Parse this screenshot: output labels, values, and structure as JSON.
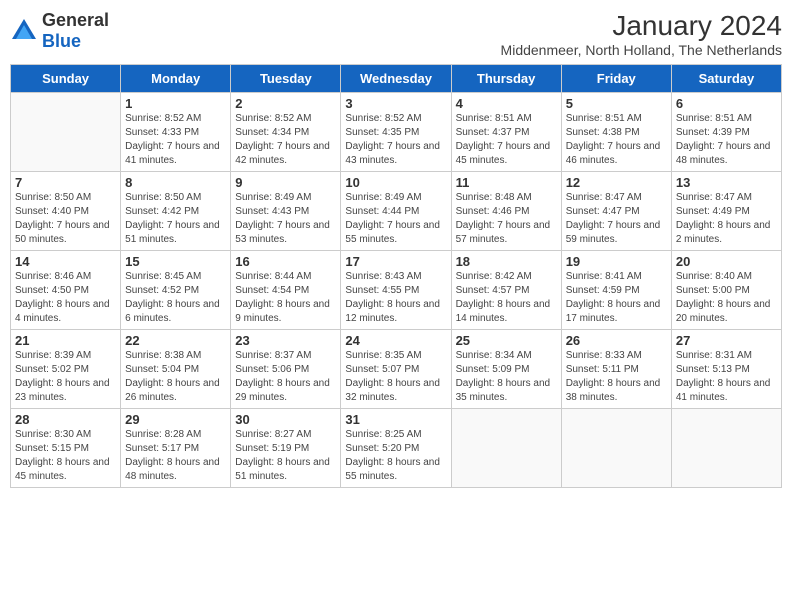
{
  "logo": {
    "general": "General",
    "blue": "Blue"
  },
  "title": "January 2024",
  "subtitle": "Middenmeer, North Holland, The Netherlands",
  "days": [
    "Sunday",
    "Monday",
    "Tuesday",
    "Wednesday",
    "Thursday",
    "Friday",
    "Saturday"
  ],
  "weeks": [
    [
      {
        "day": "",
        "sunrise": "",
        "sunset": "",
        "daylight": ""
      },
      {
        "day": "1",
        "sunrise": "Sunrise: 8:52 AM",
        "sunset": "Sunset: 4:33 PM",
        "daylight": "Daylight: 7 hours and 41 minutes."
      },
      {
        "day": "2",
        "sunrise": "Sunrise: 8:52 AM",
        "sunset": "Sunset: 4:34 PM",
        "daylight": "Daylight: 7 hours and 42 minutes."
      },
      {
        "day": "3",
        "sunrise": "Sunrise: 8:52 AM",
        "sunset": "Sunset: 4:35 PM",
        "daylight": "Daylight: 7 hours and 43 minutes."
      },
      {
        "day": "4",
        "sunrise": "Sunrise: 8:51 AM",
        "sunset": "Sunset: 4:37 PM",
        "daylight": "Daylight: 7 hours and 45 minutes."
      },
      {
        "day": "5",
        "sunrise": "Sunrise: 8:51 AM",
        "sunset": "Sunset: 4:38 PM",
        "daylight": "Daylight: 7 hours and 46 minutes."
      },
      {
        "day": "6",
        "sunrise": "Sunrise: 8:51 AM",
        "sunset": "Sunset: 4:39 PM",
        "daylight": "Daylight: 7 hours and 48 minutes."
      }
    ],
    [
      {
        "day": "7",
        "sunrise": "Sunrise: 8:50 AM",
        "sunset": "Sunset: 4:40 PM",
        "daylight": "Daylight: 7 hours and 50 minutes."
      },
      {
        "day": "8",
        "sunrise": "Sunrise: 8:50 AM",
        "sunset": "Sunset: 4:42 PM",
        "daylight": "Daylight: 7 hours and 51 minutes."
      },
      {
        "day": "9",
        "sunrise": "Sunrise: 8:49 AM",
        "sunset": "Sunset: 4:43 PM",
        "daylight": "Daylight: 7 hours and 53 minutes."
      },
      {
        "day": "10",
        "sunrise": "Sunrise: 8:49 AM",
        "sunset": "Sunset: 4:44 PM",
        "daylight": "Daylight: 7 hours and 55 minutes."
      },
      {
        "day": "11",
        "sunrise": "Sunrise: 8:48 AM",
        "sunset": "Sunset: 4:46 PM",
        "daylight": "Daylight: 7 hours and 57 minutes."
      },
      {
        "day": "12",
        "sunrise": "Sunrise: 8:47 AM",
        "sunset": "Sunset: 4:47 PM",
        "daylight": "Daylight: 7 hours and 59 minutes."
      },
      {
        "day": "13",
        "sunrise": "Sunrise: 8:47 AM",
        "sunset": "Sunset: 4:49 PM",
        "daylight": "Daylight: 8 hours and 2 minutes."
      }
    ],
    [
      {
        "day": "14",
        "sunrise": "Sunrise: 8:46 AM",
        "sunset": "Sunset: 4:50 PM",
        "daylight": "Daylight: 8 hours and 4 minutes."
      },
      {
        "day": "15",
        "sunrise": "Sunrise: 8:45 AM",
        "sunset": "Sunset: 4:52 PM",
        "daylight": "Daylight: 8 hours and 6 minutes."
      },
      {
        "day": "16",
        "sunrise": "Sunrise: 8:44 AM",
        "sunset": "Sunset: 4:54 PM",
        "daylight": "Daylight: 8 hours and 9 minutes."
      },
      {
        "day": "17",
        "sunrise": "Sunrise: 8:43 AM",
        "sunset": "Sunset: 4:55 PM",
        "daylight": "Daylight: 8 hours and 12 minutes."
      },
      {
        "day": "18",
        "sunrise": "Sunrise: 8:42 AM",
        "sunset": "Sunset: 4:57 PM",
        "daylight": "Daylight: 8 hours and 14 minutes."
      },
      {
        "day": "19",
        "sunrise": "Sunrise: 8:41 AM",
        "sunset": "Sunset: 4:59 PM",
        "daylight": "Daylight: 8 hours and 17 minutes."
      },
      {
        "day": "20",
        "sunrise": "Sunrise: 8:40 AM",
        "sunset": "Sunset: 5:00 PM",
        "daylight": "Daylight: 8 hours and 20 minutes."
      }
    ],
    [
      {
        "day": "21",
        "sunrise": "Sunrise: 8:39 AM",
        "sunset": "Sunset: 5:02 PM",
        "daylight": "Daylight: 8 hours and 23 minutes."
      },
      {
        "day": "22",
        "sunrise": "Sunrise: 8:38 AM",
        "sunset": "Sunset: 5:04 PM",
        "daylight": "Daylight: 8 hours and 26 minutes."
      },
      {
        "day": "23",
        "sunrise": "Sunrise: 8:37 AM",
        "sunset": "Sunset: 5:06 PM",
        "daylight": "Daylight: 8 hours and 29 minutes."
      },
      {
        "day": "24",
        "sunrise": "Sunrise: 8:35 AM",
        "sunset": "Sunset: 5:07 PM",
        "daylight": "Daylight: 8 hours and 32 minutes."
      },
      {
        "day": "25",
        "sunrise": "Sunrise: 8:34 AM",
        "sunset": "Sunset: 5:09 PM",
        "daylight": "Daylight: 8 hours and 35 minutes."
      },
      {
        "day": "26",
        "sunrise": "Sunrise: 8:33 AM",
        "sunset": "Sunset: 5:11 PM",
        "daylight": "Daylight: 8 hours and 38 minutes."
      },
      {
        "day": "27",
        "sunrise": "Sunrise: 8:31 AM",
        "sunset": "Sunset: 5:13 PM",
        "daylight": "Daylight: 8 hours and 41 minutes."
      }
    ],
    [
      {
        "day": "28",
        "sunrise": "Sunrise: 8:30 AM",
        "sunset": "Sunset: 5:15 PM",
        "daylight": "Daylight: 8 hours and 45 minutes."
      },
      {
        "day": "29",
        "sunrise": "Sunrise: 8:28 AM",
        "sunset": "Sunset: 5:17 PM",
        "daylight": "Daylight: 8 hours and 48 minutes."
      },
      {
        "day": "30",
        "sunrise": "Sunrise: 8:27 AM",
        "sunset": "Sunset: 5:19 PM",
        "daylight": "Daylight: 8 hours and 51 minutes."
      },
      {
        "day": "31",
        "sunrise": "Sunrise: 8:25 AM",
        "sunset": "Sunset: 5:20 PM",
        "daylight": "Daylight: 8 hours and 55 minutes."
      },
      {
        "day": "",
        "sunrise": "",
        "sunset": "",
        "daylight": ""
      },
      {
        "day": "",
        "sunrise": "",
        "sunset": "",
        "daylight": ""
      },
      {
        "day": "",
        "sunrise": "",
        "sunset": "",
        "daylight": ""
      }
    ]
  ]
}
